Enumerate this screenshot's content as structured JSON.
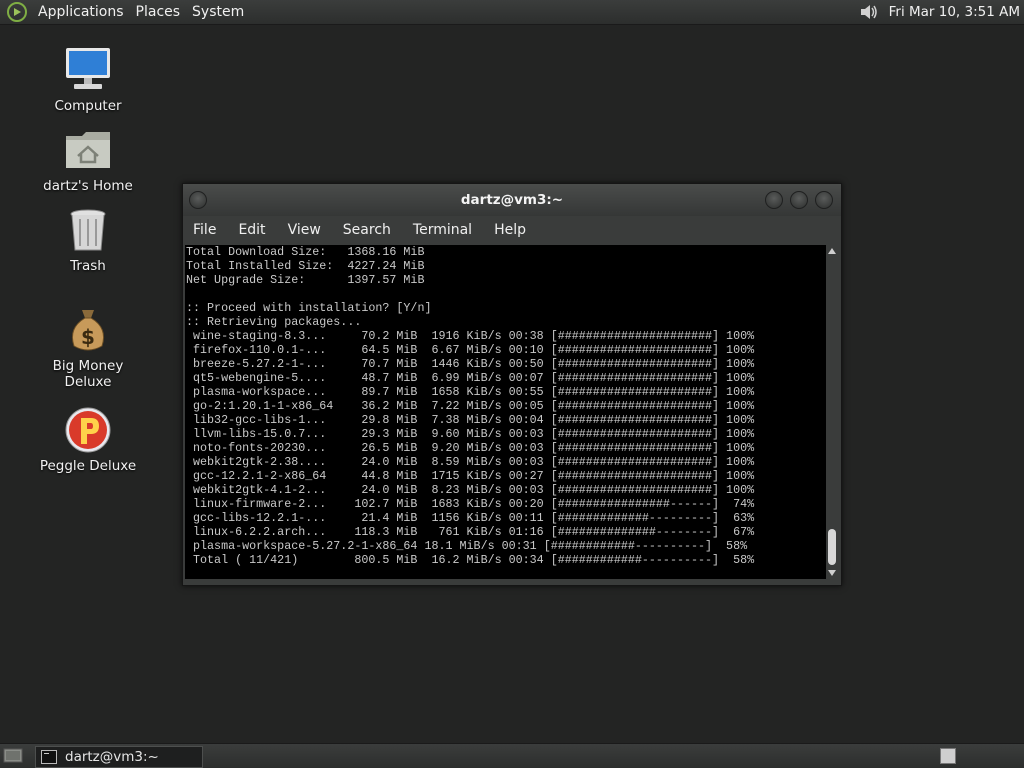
{
  "top_panel": {
    "menus": [
      "Applications",
      "Places",
      "System"
    ],
    "clock": "Fri Mar 10,  3:51 AM"
  },
  "desktop": {
    "icons": [
      {
        "label": "Computer",
        "icon": "computer-icon"
      },
      {
        "label": "dartz's Home",
        "icon": "home-folder-icon"
      },
      {
        "label": "Trash",
        "icon": "trash-icon"
      },
      {
        "label": "Big Money Deluxe",
        "icon": "money-bag-icon"
      },
      {
        "label": "Peggle Deluxe",
        "icon": "peggle-icon"
      }
    ]
  },
  "terminal": {
    "title": "dartz@vm3:~",
    "menu": [
      "File",
      "Edit",
      "View",
      "Search",
      "Terminal",
      "Help"
    ],
    "lines": [
      "Total Download Size:   1368.16 MiB",
      "Total Installed Size:  4227.24 MiB",
      "Net Upgrade Size:      1397.57 MiB",
      "",
      ":: Proceed with installation? [Y/n]",
      ":: Retrieving packages...",
      " wine-staging-8.3...     70.2 MiB  1916 KiB/s 00:38 [######################] 100%",
      " firefox-110.0.1-...     64.5 MiB  6.67 MiB/s 00:10 [######################] 100%",
      " breeze-5.27.2-1-...     70.7 MiB  1446 KiB/s 00:50 [######################] 100%",
      " qt5-webengine-5....     48.7 MiB  6.99 MiB/s 00:07 [######################] 100%",
      " plasma-workspace...     89.7 MiB  1658 KiB/s 00:55 [######################] 100%",
      " go-2:1.20.1-1-x86_64    36.2 MiB  7.22 MiB/s 00:05 [######################] 100%",
      " lib32-gcc-libs-1...     29.8 MiB  7.38 MiB/s 00:04 [######################] 100%",
      " llvm-libs-15.0.7...     29.3 MiB  9.60 MiB/s 00:03 [######################] 100%",
      " noto-fonts-20230...     26.5 MiB  9.20 MiB/s 00:03 [######################] 100%",
      " webkit2gtk-2.38....     24.0 MiB  8.59 MiB/s 00:03 [######################] 100%",
      " gcc-12.2.1-2-x86_64     44.8 MiB  1715 KiB/s 00:27 [######################] 100%",
      " webkit2gtk-4.1-2...     24.0 MiB  8.23 MiB/s 00:03 [######################] 100%",
      " linux-firmware-2...    102.7 MiB  1683 KiB/s 00:20 [################------]  74%",
      " gcc-libs-12.2.1-...     21.4 MiB  1156 KiB/s 00:11 [#############---------]  63%",
      " linux-6.2.2.arch...    118.3 MiB   761 KiB/s 01:16 [##############--------]  67%",
      " plasma-workspace-5.27.2-1-x86_64 18.1 MiB/s 00:31 [############----------]  58%",
      " Total ( 11/421)        800.5 MiB  16.2 MiB/s 00:34 [############----------]  58%"
    ]
  },
  "bottom_panel": {
    "tasks": [
      "dartz@vm3:~"
    ]
  }
}
